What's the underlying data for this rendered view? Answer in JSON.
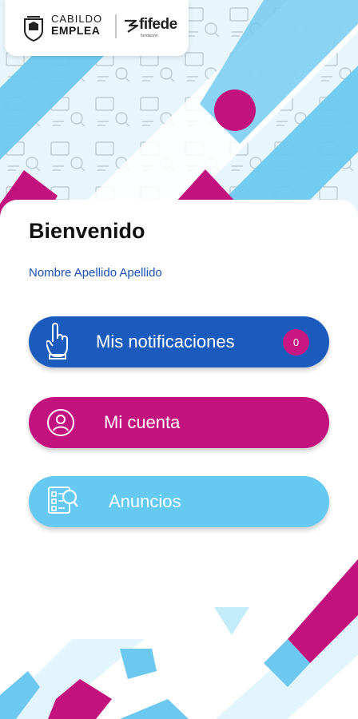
{
  "brand": {
    "cabildo_line1": "CABILDO",
    "cabildo_line2": "EMPLEA",
    "fifede_name": "fifede",
    "fifede_sub": "fundación"
  },
  "welcome": {
    "title": "Bienvenido",
    "user_name": "Nombre Apellido Apellido"
  },
  "menu": {
    "notifications": {
      "label": "Mis notificaciones",
      "count": "0",
      "icon": "pointing-hand-icon"
    },
    "account": {
      "label": "Mi cuenta",
      "icon": "user-icon"
    },
    "ads": {
      "label": "Anuncios",
      "icon": "job-board-search-icon"
    }
  },
  "colors": {
    "primary_blue": "#1b5bbd",
    "magenta": "#c2127d",
    "light_blue": "#66c9f1",
    "user_text": "#1a4fb3"
  }
}
